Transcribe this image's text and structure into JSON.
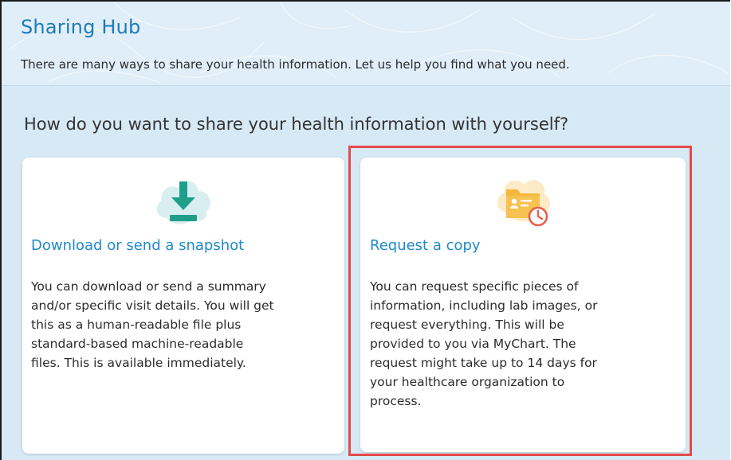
{
  "header": {
    "title": "Sharing Hub",
    "subtitle": "There are many ways to share your health information. Let us help you find what you need."
  },
  "main": {
    "question": "How do you want to share your health information with yourself?",
    "cards": [
      {
        "icon": "download-icon",
        "title": "Download or send a snapshot",
        "lines": [
          "You can download or send a summary",
          "and/or specific visit details. You will get",
          "this as a human-readable file plus",
          "standard-based machine-readable",
          "files. This is available immediately."
        ]
      },
      {
        "icon": "folder-clock-icon",
        "title": "Request a copy",
        "lines": [
          "You can request specific pieces of",
          "information, including lab images, or",
          "request everything. This will be",
          "provided to you via MyChart. The",
          "request might take up to 14 days for",
          "your healthcare organization to",
          "process."
        ]
      }
    ]
  },
  "colors": {
    "title_blue": "#1f7ab8",
    "link_blue": "#1f8ac9",
    "background": "#d7e9f5",
    "highlight_red": "#e24b4b",
    "download_teal": "#1f9f8a",
    "folder_amber": "#f5b83d",
    "clock_red": "#e8604c"
  }
}
